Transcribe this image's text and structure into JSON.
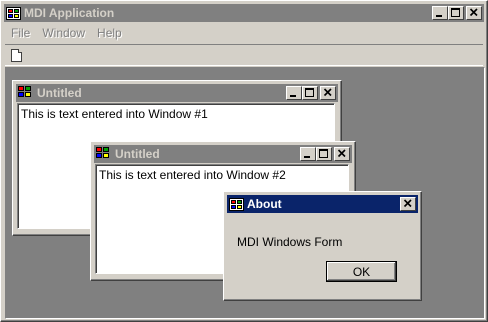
{
  "app": {
    "title": "MDI Application",
    "menu": [
      "File",
      "Window",
      "Help"
    ],
    "toolbar_icon": "new-document-icon"
  },
  "child1": {
    "title": "Untitled",
    "text": "This is text entered into Window #1"
  },
  "child2": {
    "title": "Untitled",
    "text": "This is text entered into Window #2"
  },
  "about": {
    "title": "About",
    "message": "MDI Windows Form",
    "ok_label": "OK"
  },
  "colors": {
    "desktop": "#808080",
    "face": "#d4d0c8",
    "active_title": "#0a246a",
    "inactive_title": "#808080"
  }
}
